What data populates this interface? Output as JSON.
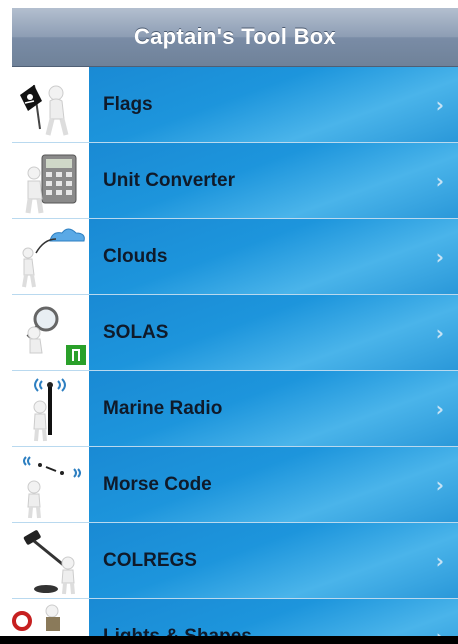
{
  "navbar": {
    "title": "Captain's Tool Box"
  },
  "menu": {
    "items": [
      {
        "label": "Flags",
        "icon": "pirate-flag-icon"
      },
      {
        "label": "Unit Converter",
        "icon": "calculator-icon"
      },
      {
        "label": "Clouds",
        "icon": "cloud-icon"
      },
      {
        "label": "SOLAS",
        "icon": "magnifier-exit-icon"
      },
      {
        "label": "Marine Radio",
        "icon": "radio-antenna-icon"
      },
      {
        "label": "Morse Code",
        "icon": "morse-signal-icon"
      },
      {
        "label": "COLREGS",
        "icon": "gavel-icon"
      },
      {
        "label": "Lights & Shapes",
        "icon": "lights-shapes-icon"
      }
    ],
    "chevron": "›"
  },
  "colors": {
    "cell_blue": "#1d95dc",
    "navbar": "#8d9db4",
    "label_text": "#0f1a2a"
  }
}
